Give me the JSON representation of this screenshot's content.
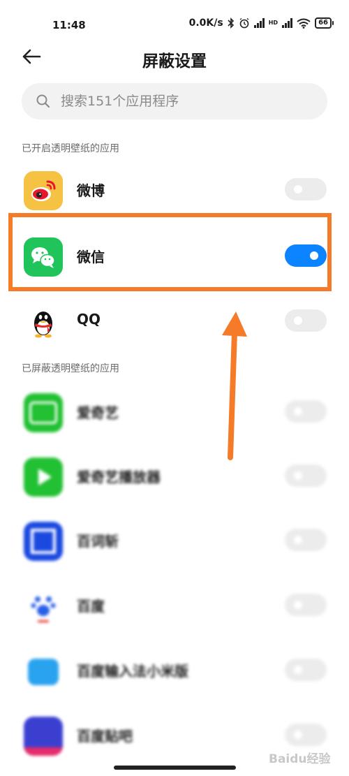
{
  "status_bar": {
    "time": "11:48",
    "net_speed": "0.0K/s",
    "hd_label": "HD",
    "battery": "66"
  },
  "header": {
    "title": "屏蔽设置"
  },
  "search": {
    "placeholder": "搜索151个应用程序"
  },
  "sections": {
    "enabled_label": "已开启透明壁纸的应用",
    "blocked_label": "已屏蔽透明壁纸的应用"
  },
  "enabled_apps": [
    {
      "name": "微博",
      "toggle_on": false,
      "icon": "weibo-icon"
    },
    {
      "name": "微信",
      "toggle_on": true,
      "icon": "wechat-icon"
    },
    {
      "name": "QQ",
      "toggle_on": false,
      "icon": "qq-icon"
    }
  ],
  "blocked_apps": [
    {
      "name": "爱奇艺",
      "toggle_on": false,
      "icon": "iqiyi-icon"
    },
    {
      "name": "爱奇艺播放器",
      "toggle_on": false,
      "icon": "iqiyi-player-icon"
    },
    {
      "name": "百词斩",
      "toggle_on": false,
      "icon": "baicizhan-icon"
    },
    {
      "name": "百度",
      "toggle_on": false,
      "icon": "baidu-icon"
    },
    {
      "name": "百度输入法小米版",
      "toggle_on": false,
      "icon": "baidu-input-icon"
    },
    {
      "name": "百度贴吧",
      "toggle_on": false,
      "icon": "baidu-tieba-icon"
    }
  ],
  "colors": {
    "accent": "#0d84ff",
    "annotation": "#f57b29",
    "wechat": "#21c45a",
    "weibo": "#f6c244"
  },
  "watermark": "Baidu经验"
}
